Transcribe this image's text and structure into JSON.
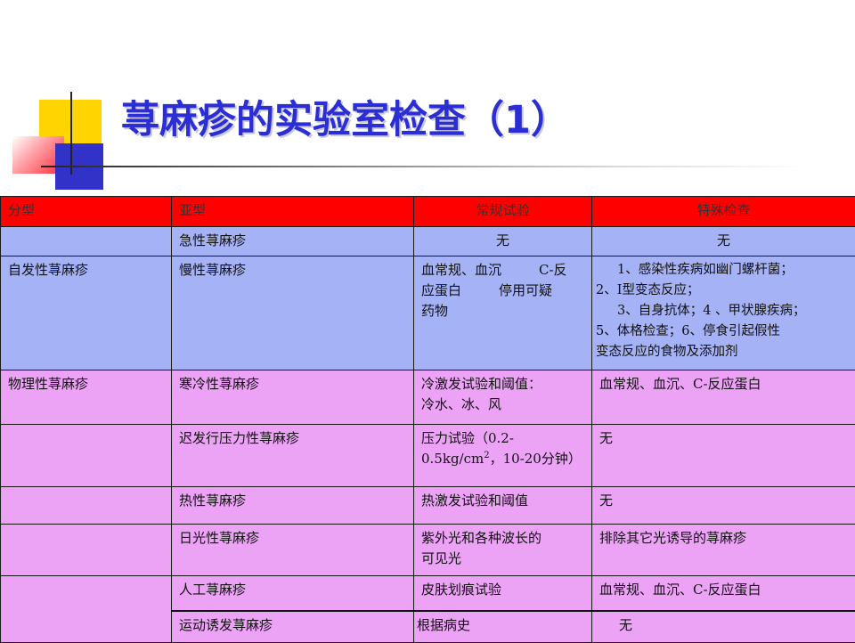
{
  "title": "荨麻疹的实验室检查（1）",
  "headers": {
    "type": "分型",
    "subtype": "亚型",
    "routine": "常规试验",
    "special": "特殊检查"
  },
  "rows": [
    {
      "type": "",
      "subtype": "急性荨麻疹",
      "routine": "无",
      "special": "无"
    },
    {
      "type": "自发性荨麻疹",
      "subtype": "慢性荨麻疹",
      "routine_a": "血常规、血沉",
      "routine_b": "C-反",
      "routine_c": "应蛋白",
      "routine_d": "停用可疑",
      "routine_e": "药物",
      "special_l1": "1、感染性疾病如幽门螺杆菌；",
      "special_l2": "2、Ⅰ型变态反应；",
      "special_l3": "3、自身抗体；4 、甲状腺疾病；",
      "special_l4": "5、体格检查；6、停食引起假性",
      "special_l5": "变态反应的食物及添加剂"
    },
    {
      "type": "物理性荨麻疹",
      "subtype": "寒冷性荨麻疹",
      "routine_l1": "冷激发试验和阈值：",
      "routine_l2": "冷水、冰、风",
      "special": "血常规、血沉、C-反应蛋白"
    },
    {
      "type": "",
      "subtype": "迟发行压力性荨麻疹",
      "routine_l1": "压力试验（0.2-",
      "routine_l2a": "0.5kg/cm",
      "routine_sup": "2",
      "routine_l2b": "，10-20分钟）",
      "special": "无"
    },
    {
      "type": "",
      "subtype": "热性荨麻疹",
      "routine": "热激发试验和阈值",
      "special": "无"
    },
    {
      "type": "",
      "subtype": "日光性荨麻疹",
      "routine_l1": "紫外光和各种波长的",
      "routine_l2": "可见光",
      "special": "排除其它光诱导的荨麻疹"
    },
    {
      "type": "",
      "subtype": "人工荨麻疹",
      "routine": "皮肤划痕试验",
      "special": "血常规、血沉、C-反应蛋白"
    },
    {
      "type": "",
      "subtype": "运动诱发荨麻疹",
      "routine": "根据病史",
      "special": "无"
    }
  ]
}
